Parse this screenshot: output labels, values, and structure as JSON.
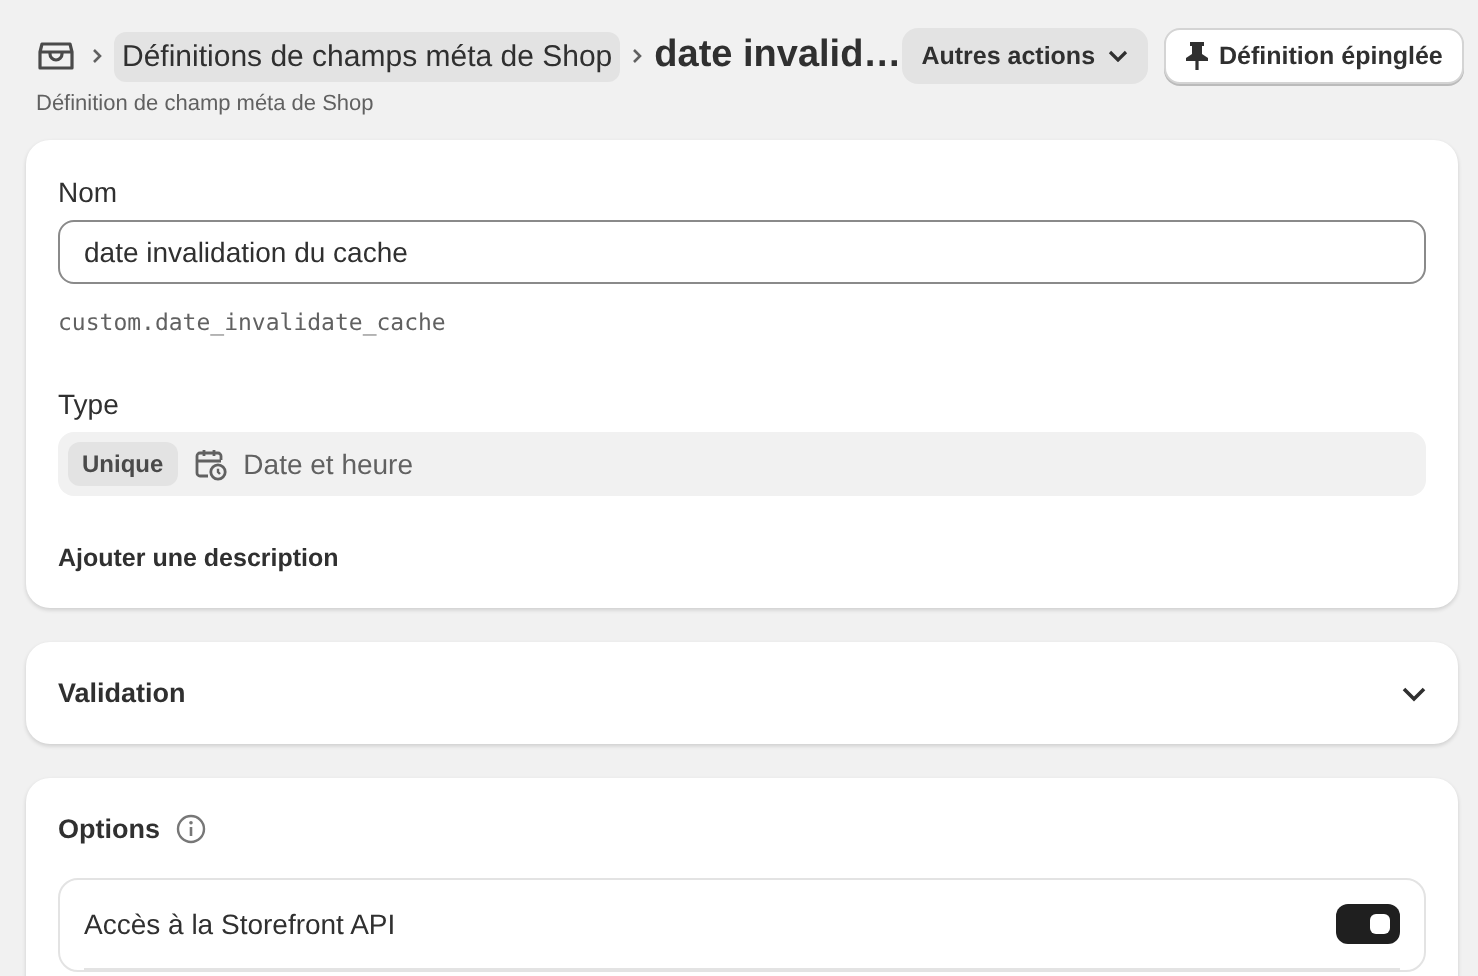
{
  "breadcrumb": {
    "parent": "Définitions de champs méta de Shop",
    "title": "date invalid…",
    "subtitle": "Définition de champ méta de Shop"
  },
  "actions": [
    {
      "label": "Autres actions",
      "kind": "menu"
    },
    {
      "label": "Définition épinglée",
      "kind": "pin"
    }
  ],
  "details": {
    "name_label": "Nom",
    "name_value": "date invalidation du cache",
    "key": "custom.date_invalidate_cache",
    "type_label": "Type",
    "type_badge": "Unique",
    "type_value": "Date et heure",
    "add_description": "Ajouter une description"
  },
  "validation": {
    "title": "Validation",
    "expanded": false
  },
  "options": {
    "title": "Options",
    "items": [
      {
        "label": "Accès à la Storefront API",
        "on": true
      }
    ]
  }
}
